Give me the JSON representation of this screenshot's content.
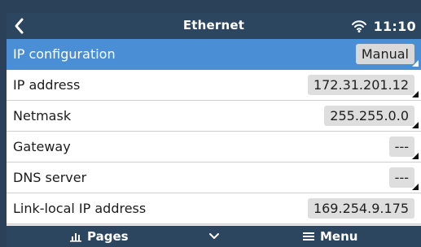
{
  "header": {
    "title": "Ethernet",
    "time": "11:10"
  },
  "rows": [
    {
      "label": "IP configuration",
      "value": "Manual"
    },
    {
      "label": "IP address",
      "value": "172.31.201.12"
    },
    {
      "label": "Netmask",
      "value": "255.255.0.0"
    },
    {
      "label": "Gateway",
      "value": "---"
    },
    {
      "label": "DNS server",
      "value": "---"
    },
    {
      "label": "Link-local IP address",
      "value": "169.254.9.175"
    }
  ],
  "footer": {
    "pages_label": "Pages",
    "menu_label": "Menu"
  },
  "icons": {
    "back": "chevron-left-icon",
    "wifi": "wifi-icon",
    "pages": "pages-chart-icon",
    "down": "chevron-down-icon",
    "menu": "hamburger-menu-icon"
  },
  "colors": {
    "header_bg": "#2c4660",
    "selected_row": "#4a8fd6",
    "value_box": "#dedede"
  }
}
